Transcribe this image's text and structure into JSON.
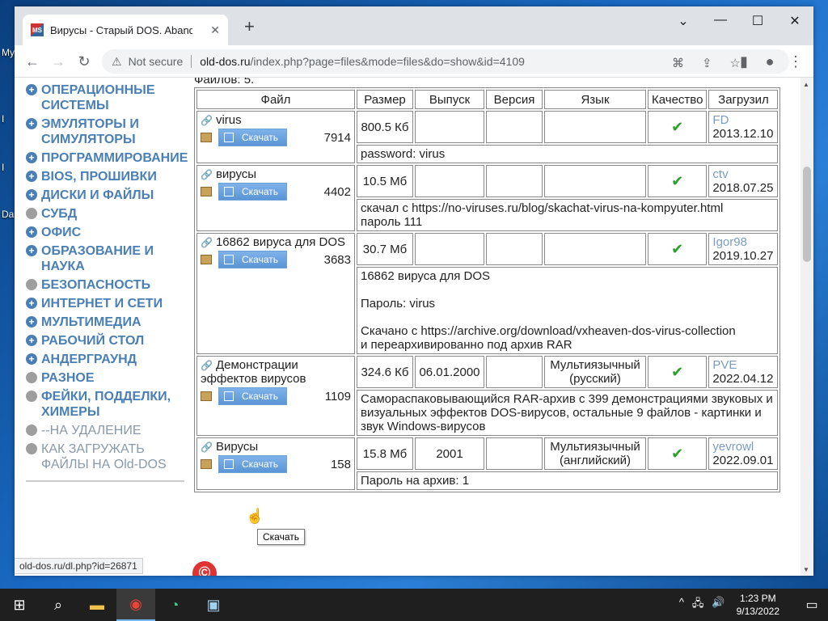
{
  "desktop": {
    "labels": [
      "My",
      "I",
      "I",
      "Da"
    ]
  },
  "browser": {
    "tab_title": "Вирусы - Старый DOS. Abandon",
    "tab_favicon": "MS",
    "new_tab": "+",
    "window_controls": {
      "minimize": "—",
      "maximize": "☐",
      "close": "✕",
      "menu": "⌄"
    },
    "nav": {
      "back": "←",
      "forward": "→",
      "reload": "↻"
    },
    "omnibox": {
      "not_secure": "Not secure",
      "url_host": "old-dos.ru",
      "url_rest": "/index.php?page=files&mode=files&do=show&id=4109"
    },
    "status_url": "old-dos.ru/dl.php?id=26871"
  },
  "menu": [
    {
      "label": "ОПЕРАЦИОННЫЕ СИСТЕМЫ",
      "bullet": "+",
      "style": "blue"
    },
    {
      "label": "ЭМУЛЯТОРЫ И СИМУЛЯТОРЫ",
      "bullet": "+",
      "style": "blue"
    },
    {
      "label": "ПРОГРАММИРОВАНИЕ",
      "bullet": "+",
      "style": "blue"
    },
    {
      "label": "BIOS, прошивки",
      "bullet": "+",
      "style": "blue"
    },
    {
      "label": "ДИСКИ И ФАЙЛЫ",
      "bullet": "+",
      "style": "blue"
    },
    {
      "label": "СУБД",
      "bullet": "",
      "style": "gray"
    },
    {
      "label": "ОФИС",
      "bullet": "+",
      "style": "blue"
    },
    {
      "label": "ОБРАЗОВАНИЕ И НАУКА",
      "bullet": "+",
      "style": "blue"
    },
    {
      "label": "БЕЗОПАСНОСТЬ",
      "bullet": "",
      "style": "gray"
    },
    {
      "label": "ИНТЕРНЕТ И СЕТИ",
      "bullet": "+",
      "style": "blue"
    },
    {
      "label": "МУЛЬТИМЕДИА",
      "bullet": "+",
      "style": "blue"
    },
    {
      "label": "РАБОЧИЙ СТОЛ",
      "bullet": "+",
      "style": "blue"
    },
    {
      "label": "АНДЕРГРАУНД",
      "bullet": "+",
      "style": "blue"
    },
    {
      "label": "РАЗНОЕ",
      "bullet": "",
      "style": "gray"
    },
    {
      "label": "ФЕЙКИ, ПОДДЕЛКИ, ХИМЕРЫ",
      "bullet": "",
      "style": "gray"
    },
    {
      "label": "--НА УДАЛЕНИЕ",
      "bullet": "",
      "style": "plain"
    },
    {
      "label": "КАК ЗАГРУЖАТЬ ФАЙЛЫ НА Old-DOS",
      "bullet": "",
      "style": "plain"
    }
  ],
  "files": {
    "count_label": "Файлов: 5.",
    "headers": [
      "Файл",
      "Размер",
      "Выпуск",
      "Версия",
      "Язык",
      "Качество",
      "Загрузил"
    ],
    "download_label": "Скачать",
    "rows": [
      {
        "name": "virus",
        "count": "7914",
        "size": "800.5 Кб",
        "release": "",
        "version": "",
        "language": "",
        "quality": "✔",
        "uploader": "FD",
        "date": "2013.12.10",
        "note": "password: virus"
      },
      {
        "name": "вирусы",
        "count": "4402",
        "size": "10.5 Мб",
        "release": "",
        "version": "",
        "language": "",
        "quality": "✔",
        "uploader": "ctv",
        "date": "2018.07.25",
        "note": "скачал с https://no-viruses.ru/blog/skachat-virus-na-kompyuter.html\nпароль 111"
      },
      {
        "name": "16862 вируса для DOS",
        "count": "3683",
        "size": "30.7 Мб",
        "release": "",
        "version": "",
        "language": "",
        "quality": "✔",
        "uploader": "Igor98",
        "date": "2019.10.27",
        "note": "16862 вируса для DOS\n\nПароль: virus\n\nСкачано с https://archive.org/download/vxheaven-dos-virus-collection\nи переархивированно под архив RAR"
      },
      {
        "name": "Демонстрации эффектов вирусов",
        "count": "1109",
        "size": "324.6 Кб",
        "release": "06.01.2000",
        "version": "",
        "language": "Мультиязычный (русский)",
        "quality": "✔",
        "uploader": "PVE",
        "date": "2022.04.12",
        "note": "Самораспаковывающийся RAR-архив с 399 демонстрациями звуковых и визуальных эффектов DOS-вирусов, остальные 9 файлов - картинки и звук Windows-вирусов"
      },
      {
        "name": "Вирусы",
        "count": "158",
        "size": "15.8 Мб",
        "release": "2001",
        "version": "",
        "language": "Мультиязычный (английский)",
        "quality": "✔",
        "uploader": "yevrowl",
        "date": "2022.09.01",
        "note": "Пароль на архив: 1"
      }
    ],
    "tooltip": "Скачать"
  },
  "taskbar": {
    "time": "1:23 PM",
    "date": "9/13/2022",
    "tray_icons": [
      "^",
      "🖧",
      "🔊"
    ]
  }
}
